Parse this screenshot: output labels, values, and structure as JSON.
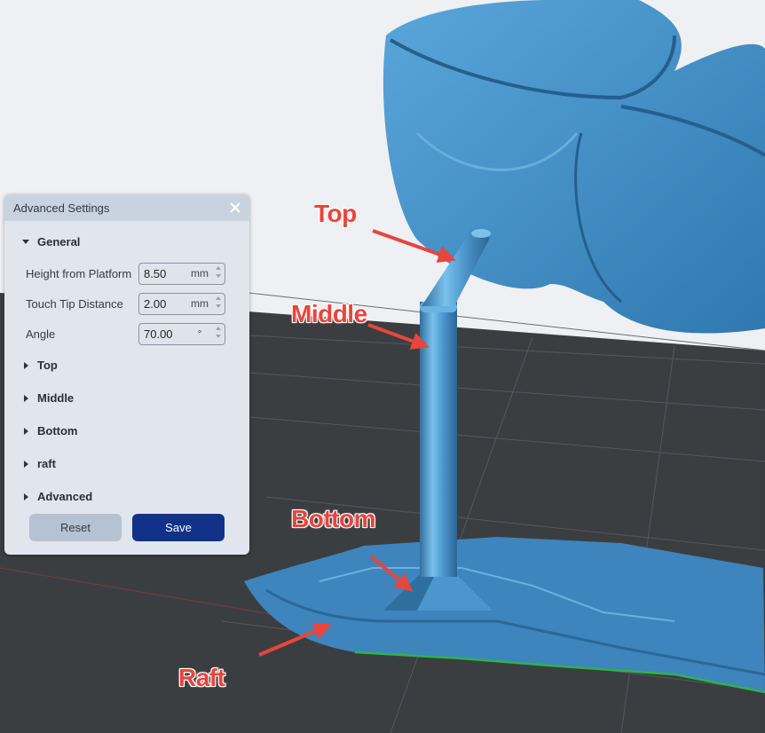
{
  "panel": {
    "title": "Advanced Settings",
    "sections": {
      "general": "General",
      "top": "Top",
      "middle": "Middle",
      "bottom": "Bottom",
      "raft": "raft",
      "advanced": "Advanced"
    },
    "fields": [
      {
        "label": "Height from Platform",
        "value": "8.50",
        "unit": "mm"
      },
      {
        "label": "Touch Tip Distance",
        "value": "2.00",
        "unit": "mm"
      },
      {
        "label": "Angle",
        "value": "70.00",
        "unit": "°"
      }
    ],
    "reset_label": "Reset",
    "save_label": "Save"
  },
  "annotations": {
    "top": "Top",
    "middle": "Middle",
    "bottom": "Bottom",
    "raft": "Raft"
  },
  "colors": {
    "model": "#3f8ec7",
    "floor": "#3c3f42",
    "accent": "#12328a",
    "annotation": "#e8453c"
  }
}
